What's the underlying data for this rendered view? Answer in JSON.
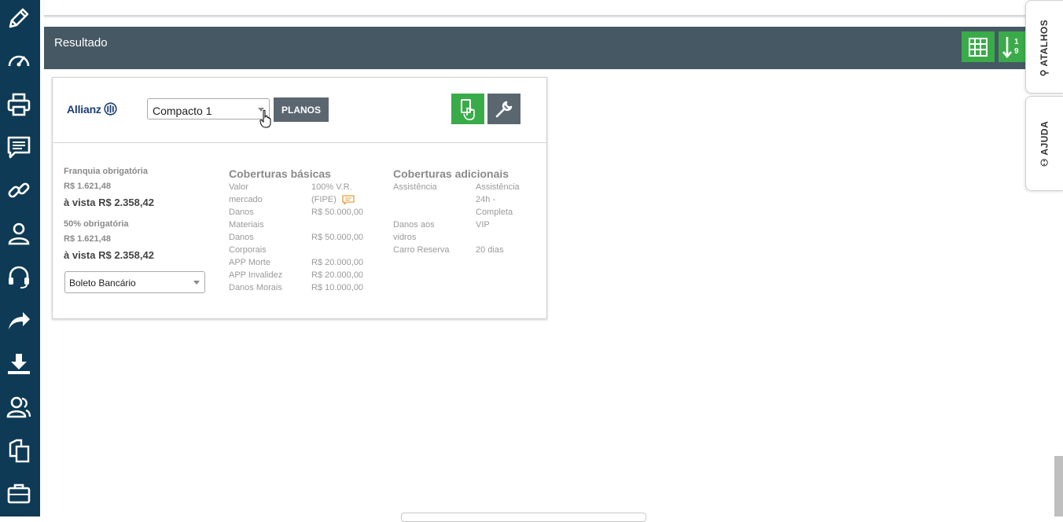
{
  "sidebar": {
    "icons": [
      "pencil-icon",
      "speedometer-icon",
      "printer-icon",
      "chat-icon",
      "link-icon",
      "user-icon",
      "headset-icon",
      "share-icon",
      "download-icon",
      "users-icon",
      "copy-icon",
      "briefcase-icon"
    ]
  },
  "header": {
    "title": "Resultado",
    "btn2_label_line1": "1",
    "btn2_label_line2": "9"
  },
  "quote": {
    "insurer": "Allianz",
    "plan_value": "Compacto 1",
    "planos_label": "PLANOS",
    "franquia_label": "Franquia obrigatória",
    "franquia_value": "R$ 1.621,48",
    "franquia_avista": "à vista R$ 2.358,42",
    "fifty_label": "50% obrigatória",
    "fifty_value": "R$ 1.621,48",
    "fifty_avista": "à vista R$ 2.358,42",
    "payment_value": "Boleto Bancário",
    "basic_title": "Coberturas básicas",
    "basic": [
      {
        "name": "Valor mercado",
        "value": "100% V.R. (FIPE)"
      },
      {
        "name": "Danos Materiais",
        "value": "R$ 50.000,00"
      },
      {
        "name": "Danos Corporais",
        "value": "R$ 50.000,00"
      },
      {
        "name": "APP Morte",
        "value": "R$ 20.000,00"
      },
      {
        "name": "APP Invalidez",
        "value": "R$ 20.000,00"
      },
      {
        "name": "Danos Morais",
        "value": "R$ 10.000,00"
      }
    ],
    "additional_title": "Coberturas adicionais",
    "additional": [
      {
        "name": "Assistência",
        "value": "Assistência 24h - Completa"
      },
      {
        "name": "Danos aos vidros",
        "value": "VIP"
      },
      {
        "name": "Carro Reserva",
        "value": "20 dias"
      }
    ]
  },
  "right_tabs": {
    "atalhos": "ATALHOS",
    "ajuda": "AJUDA"
  },
  "colors": {
    "sidebar": "#0e3a55",
    "header": "#455863",
    "green": "#3aab49",
    "gray_button": "#5b6770"
  }
}
